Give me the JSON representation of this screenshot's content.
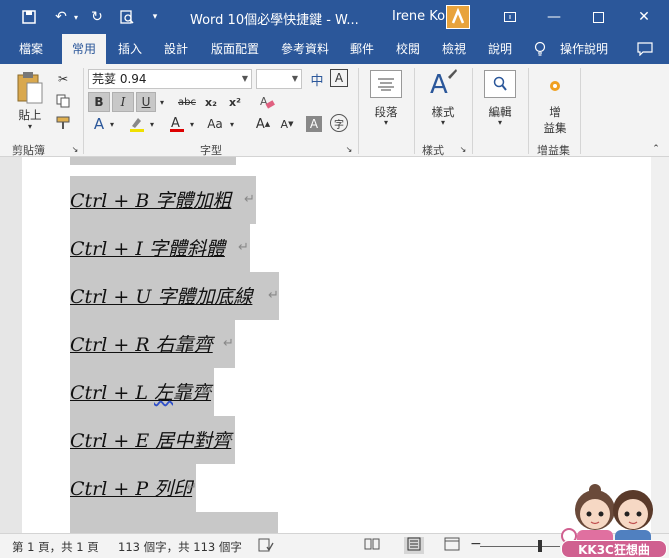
{
  "titlebar": {
    "doc_title": "Word 10個必學快捷鍵 - W...",
    "user_name": "Irene Ko",
    "colors": {
      "bg": "#2b579a"
    }
  },
  "tabs": [
    {
      "label": "檔案"
    },
    {
      "label": "常用"
    },
    {
      "label": "插入"
    },
    {
      "label": "設計"
    },
    {
      "label": "版面配置"
    },
    {
      "label": "參考資料"
    },
    {
      "label": "郵件"
    },
    {
      "label": "校閱"
    },
    {
      "label": "檢視"
    },
    {
      "label": "說明"
    }
  ],
  "tell_me": "操作說明",
  "ribbon": {
    "clipboard": {
      "paste_label": "貼上",
      "group_label": "剪貼簿"
    },
    "font": {
      "font_name": "芫荽 0.94",
      "font_size": "",
      "group_label": "字型",
      "phonetic": "中",
      "bold": "B",
      "italic": "I",
      "underline": "U",
      "strike": "abc",
      "sub": "x₂",
      "sup": "x²",
      "case": "Aa",
      "grow": "A",
      "shrink": "A",
      "clear": "A",
      "enclose": "字"
    },
    "paragraph": {
      "label": "段落"
    },
    "styles": {
      "label": "樣式",
      "group_label": "樣式"
    },
    "editing": {
      "label": "編輯"
    },
    "addins": {
      "label_1": "增",
      "label_2": "益集",
      "group_label": "增益集"
    }
  },
  "document": {
    "lines": [
      {
        "text": "Ctrl + B  字體加粗"
      },
      {
        "text": "Ctrl + I  字體斜體"
      },
      {
        "text": "Ctrl + U  字體加底線"
      },
      {
        "text": "Ctrl + R  右靠齊"
      },
      {
        "text_a": "Ctrl + L  ",
        "text_b": "左",
        "text_c": "靠齊"
      },
      {
        "text": "Ctrl + E  居中對齊"
      },
      {
        "text": "Ctrl + P  列印"
      }
    ],
    "para_mark": "↵"
  },
  "statusbar": {
    "page": "第 1 頁，共 1 頁",
    "words": "113 個字，共 113 個字"
  },
  "watermark": "KK3C狂想曲"
}
